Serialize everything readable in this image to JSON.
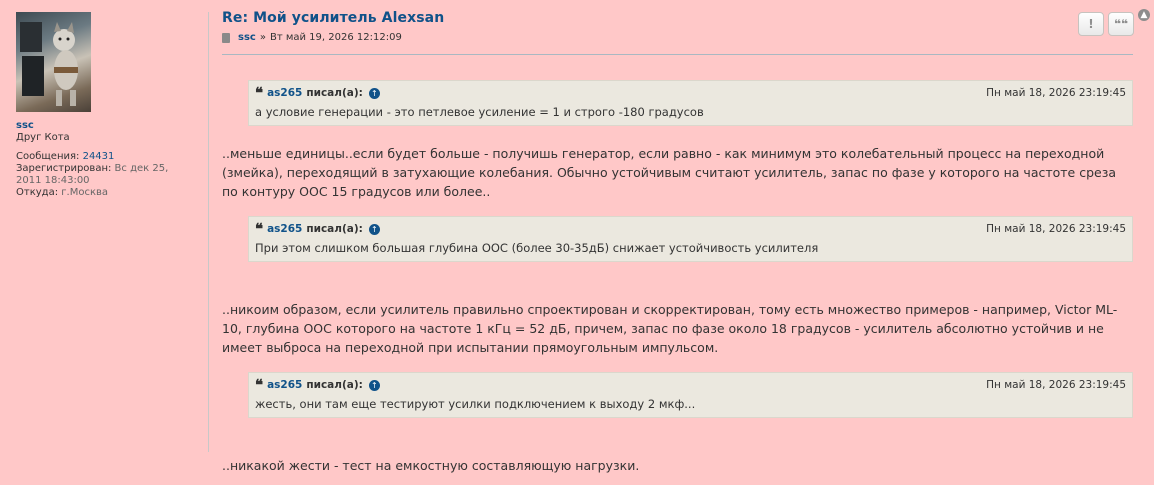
{
  "profile": {
    "username": "ssc",
    "rank": "Друг Кота",
    "messages_label": "Сообщения:",
    "messages_value": "24431",
    "registered_label": "Зарегистрирован:",
    "registered_value": "Вс дек 25, 2011 18:43:00",
    "from_label": "Откуда:",
    "from_value": "г.Москва"
  },
  "post": {
    "title": "Re: Мой усилитель Alexsan",
    "author": "ssc",
    "separator": "»",
    "date": "Вт май 19, 2026 12:12:09",
    "buttons": {
      "report": "!",
      "quote": "❝❝"
    }
  },
  "quotes": [
    {
      "author": "as265",
      "wrote": "писал(а):",
      "date": "Пн май 18, 2026 23:19:45",
      "text": "а условие генерации - это петлевое усиление = 1 и строго -180 градусов"
    },
    {
      "author": "as265",
      "wrote": "писал(а):",
      "date": "Пн май 18, 2026 23:19:45",
      "text": "При этом слишком большая глубина ООС (более 30-35дБ) снижает устойчивость усилителя"
    },
    {
      "author": "as265",
      "wrote": "писал(а):",
      "date": "Пн май 18, 2026 23:19:45",
      "text": "жесть, они там еще тестируют усилки подключением к выходу 2 мкф..."
    }
  ],
  "paragraphs": [
    "..меньше единицы..если будет больше - получишь генератор, если равно - как минимум это колебательный процесс на переходной (змейка), переходящий в затухающие колебания. Обычно устойчивым считают усилитель, запас по фазе у которого на частоте среза по контуру ООС 15 градусов или более..",
    "..никоим образом, если усилитель правильно спроектирован и скорректирован, тому есть множество примеров - например, Victor ML-10, глубина ООС которого на частоте 1 кГц = 52 дБ, причем, запас по фазе около 18 градусов - усилитель абсолютно устойчив и не имеет выброса на переходной при испытании прямоугольным импульсом.",
    "..никакой жести - тест на емкостную составляющую нагрузки."
  ],
  "colors": {
    "background": "#ffc8c8",
    "link": "#105289",
    "quote_bg": "#ebe8df"
  }
}
